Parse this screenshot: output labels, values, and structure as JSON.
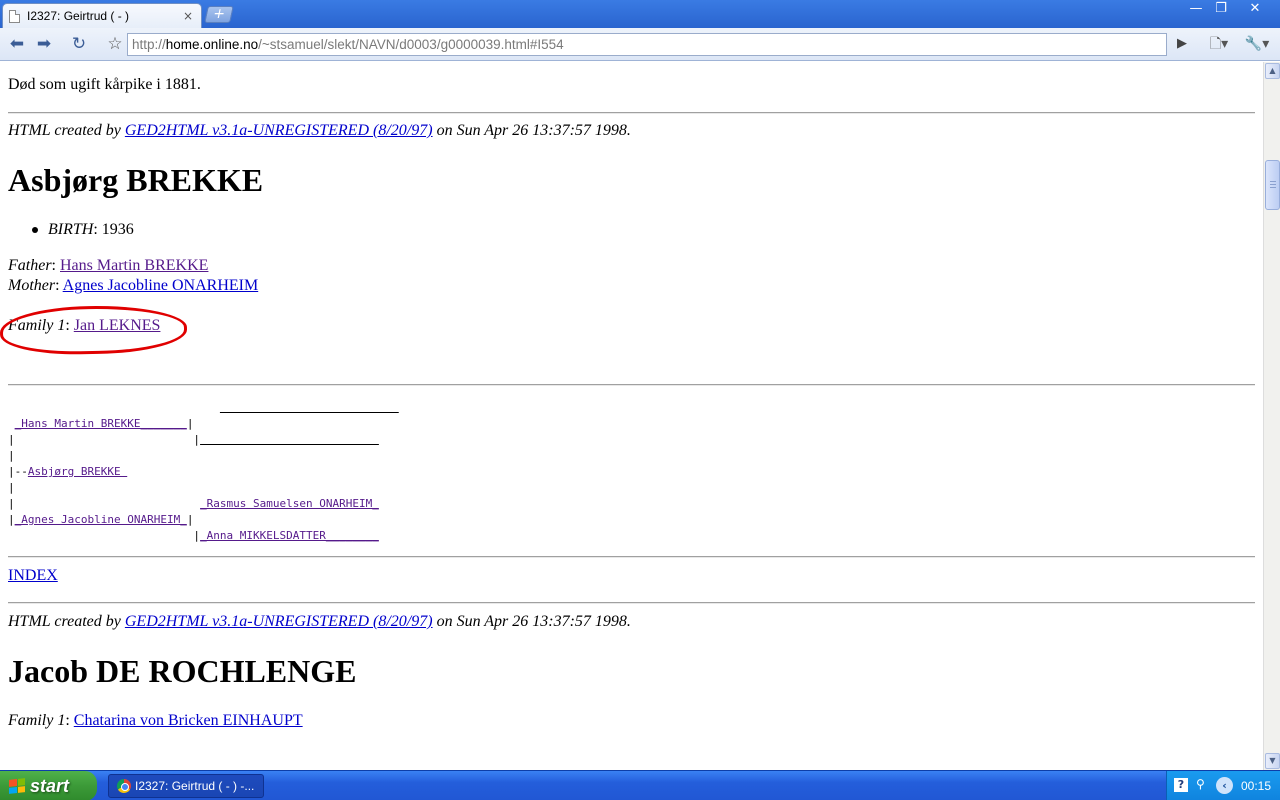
{
  "browser": {
    "tab_title": "I2327: Geirtrud ( - )",
    "tab_close": "×",
    "new_tab": "+",
    "url_prefix": "http://",
    "url_host": "home.online.no",
    "url_path": "/~stsamuel/slekt/NAVN/d0003/g0000039.html#I554",
    "window_min": "—",
    "window_max": "❐",
    "window_close": "✕"
  },
  "page": {
    "top_note": "Død som ugift kårpike i 1881.",
    "created1": {
      "prefix": "HTML created by ",
      "link": "GED2HTML v3.1a-UNREGISTERED (8/20/97)",
      "suffix": " on Sun Apr 26 13:37:57 1998."
    },
    "person1": {
      "name": "Asbjørg BREKKE",
      "birth_label": "BIRTH",
      "birth_value": ": 1936",
      "father_label": "Father",
      "father_name": "Hans Martin BREKKE ",
      "mother_label": "Mother",
      "mother_name": "Agnes Jacobline ONARHEIM ",
      "family_label": "Family 1",
      "family_name": "Jan LEKNES "
    },
    "tree": {
      "father": "_Hans Martin BREKKE_______",
      "self": "Asbjørg BREKKE ",
      "mgf": "_Rasmus Samuelsen ONARHEIM_",
      "mother": "_Agnes Jacobline ONARHEIM_",
      "mgm": "_Anna MIKKELSDATTER________"
    },
    "index_link": "INDEX",
    "created2": {
      "prefix": "HTML created by ",
      "link": "GED2HTML v3.1a-UNREGISTERED (8/20/97)",
      "suffix": " on Sun Apr 26 13:37:57 1998."
    },
    "person2": {
      "name": "Jacob DE ROCHLENGE",
      "family_label": "Family 1",
      "family_name": "Chatarina von Bricken EINHAUPT "
    }
  },
  "taskbar": {
    "start_label": "start",
    "task_item": "I2327: Geirtrud ( - ) -...",
    "tray_help": "?",
    "clock": "00:15"
  },
  "colors": {
    "link": "#0000cc",
    "visited_link": "#551a8b",
    "annotation": "#e00000"
  }
}
